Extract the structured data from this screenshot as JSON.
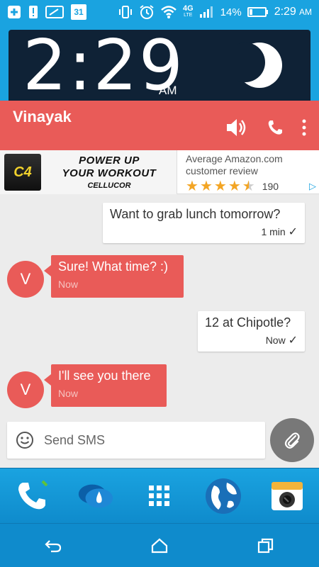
{
  "status_bar": {
    "calendar_day": "31",
    "network": "4G",
    "network_sub": "LTE",
    "battery_percent": "14%",
    "time": "2:29",
    "ampm": "AM"
  },
  "clock_widget": {
    "time": "2:29",
    "ampm": "AM",
    "weather_icon": "moon-icon"
  },
  "conversation": {
    "contact_name": "Vinayak",
    "actions": [
      "speaker-icon",
      "phone-icon",
      "more-icon"
    ]
  },
  "ad": {
    "product_label": "C4",
    "headline_line1": "POWER UP",
    "headline_line2": "YOUR WORKOUT",
    "brand": "CELLUCOR",
    "review_text": "Average Amazon.com customer review",
    "rating_stars": 4.5,
    "review_count": "190"
  },
  "messages": [
    {
      "direction": "out",
      "text": "Want to grab lunch tomorrow?",
      "time": "1 min",
      "status": "sent"
    },
    {
      "direction": "in",
      "avatar": "V",
      "text": "Sure! What time? :)",
      "time": "Now"
    },
    {
      "direction": "out",
      "text": "12 at Chipotle?",
      "time": "Now",
      "status": "sent"
    },
    {
      "direction": "in",
      "avatar": "V",
      "text": "I'll see you there",
      "time": "Now"
    }
  ],
  "composer": {
    "placeholder": "Send SMS"
  },
  "dock": [
    "phone-app-icon",
    "messages-app-icon",
    "app-drawer-icon",
    "browser-globe-icon",
    "camera-app-icon"
  ],
  "colors": {
    "accent": "#e95b58",
    "status_bar": "#1aa3e0",
    "clock_bg": "#0f2236",
    "chat_bg": "#ececec"
  }
}
